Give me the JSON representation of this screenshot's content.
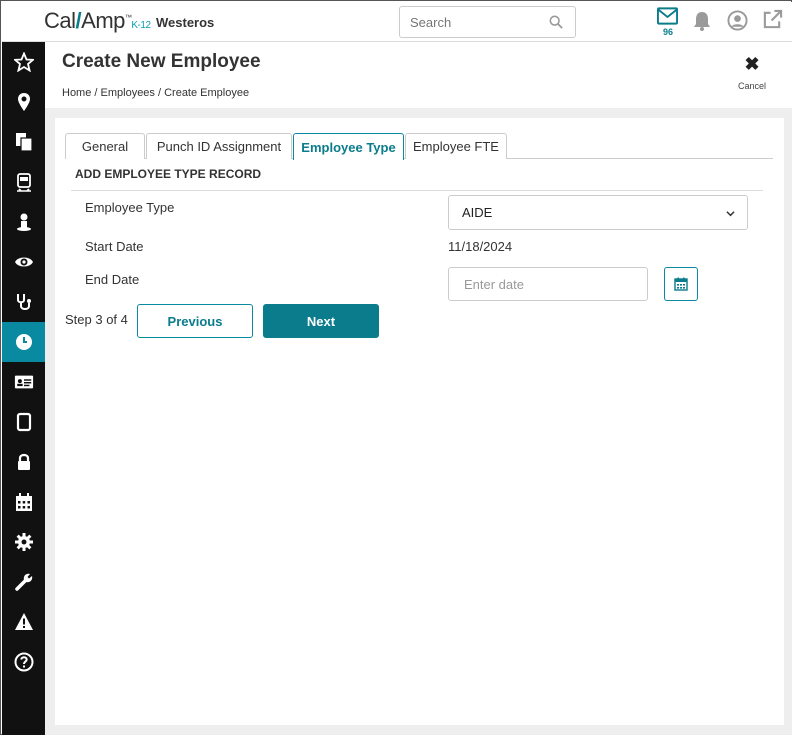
{
  "topbar": {
    "logo_main": "Cal",
    "logo_slash": "/",
    "logo_second": "Amp",
    "logo_tm": "™",
    "logo_suffix": "K-12",
    "district": "Westeros",
    "search_placeholder": "Search",
    "message_count": "96",
    "icons": [
      "mail-icon",
      "bell-icon",
      "user-circle-icon",
      "external-link-icon"
    ]
  },
  "sidebar": {
    "items": [
      {
        "icon": "star-icon"
      },
      {
        "icon": "location-pin-icon"
      },
      {
        "icon": "documents-icon"
      },
      {
        "icon": "bus-icon"
      },
      {
        "icon": "person-icon"
      },
      {
        "icon": "eye-icon"
      },
      {
        "icon": "stethoscope-icon"
      },
      {
        "icon": "clock-icon",
        "active": true
      },
      {
        "icon": "id-card-icon"
      },
      {
        "icon": "tablet-icon"
      },
      {
        "icon": "lock-icon"
      },
      {
        "icon": "calendar-icon"
      },
      {
        "icon": "gear-icon"
      },
      {
        "icon": "wrench-icon"
      },
      {
        "icon": "warning-icon"
      },
      {
        "icon": "help-icon"
      }
    ]
  },
  "header": {
    "title": "Create New Employee",
    "breadcrumb": "Home / Employees / Create Employee",
    "cancel_label": "Cancel"
  },
  "tabs": [
    {
      "label": "General"
    },
    {
      "label": "Punch ID Assignment"
    },
    {
      "label": "Employee Type",
      "active": true
    },
    {
      "label": "Employee FTE"
    }
  ],
  "form": {
    "section_title": "ADD EMPLOYEE TYPE RECORD",
    "employee_type_label": "Employee Type",
    "employee_type_value": "AIDE",
    "start_date_label": "Start Date",
    "start_date_value": "11/18/2024",
    "end_date_label": "End Date",
    "end_date_placeholder": "Enter date"
  },
  "footer": {
    "step_text": "Step 3 of 4",
    "previous_label": "Previous",
    "next_label": "Next"
  },
  "colors": {
    "accent": "#0a7c8c",
    "sidebar_bg": "#111111",
    "sidebar_active": "#0a8aa0"
  }
}
